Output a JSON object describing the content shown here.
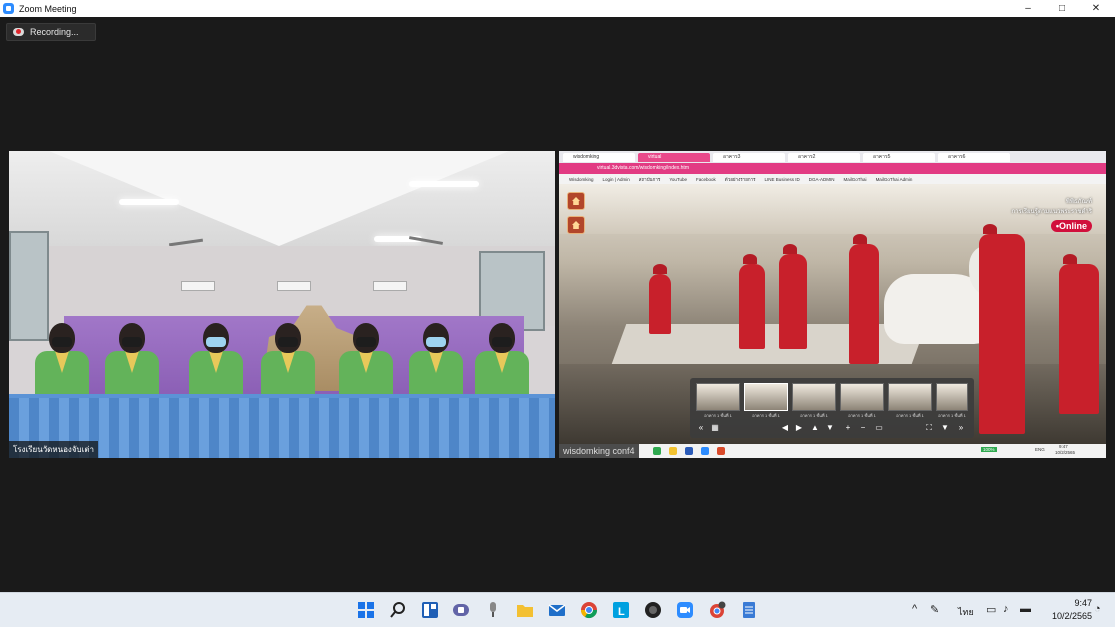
{
  "window": {
    "title": "Zoom Meeting",
    "controls": {
      "minimize": "–",
      "maximize": "□",
      "close": "✕"
    }
  },
  "meeting": {
    "recording_label": "Recording...",
    "participants": [
      {
        "name": "โรงเรียนวัดหนองจับเต่า"
      },
      {
        "name": "wisdomking conf4"
      }
    ]
  },
  "shared_screen": {
    "tabs": [
      "wisdomking",
      "virtual",
      "อาคาร3",
      "อาคาร2",
      "อาคาร5",
      "อาคาร6"
    ],
    "url": "virtual.3dvista.com/wisdomking/index.htm",
    "bookmarks": [
      "Wisdomking",
      "Login | Admin",
      "สถาบันการ",
      "YouTube",
      "Facebook",
      "ตัวอย่างรายการ",
      "LINE Business ID",
      "DGA-ADMIN",
      "MailGoThai",
      "MailGoThai Admin"
    ],
    "promo_lines": [
      "พิพิธภัณฑ์",
      "การเรียนรู้ตามแนวพระราชดำริ"
    ],
    "online_badge": "•Online",
    "thumbnails": [
      "อาคาร 1 ชั้นที่ 1",
      "อาคาร 1 ชั้นที่ 1",
      "อาคาร 1 ชั้นที่ 1",
      "อาคาร 1 ชั้นที่ 1",
      "อาคาร 1 ชั้นที่ 1",
      "อาคาร 1 ชั้นที่ 1"
    ],
    "taskbar": {
      "zoom": "100%",
      "lang": "ENG",
      "time": "9:47",
      "date": "10/2/2565"
    }
  },
  "taskbar": {
    "apps": [
      "start-icon",
      "search-icon",
      "widgets-icon",
      "teams-chat-icon",
      "microphone-app-icon",
      "file-explorer-icon",
      "mail-icon",
      "chrome-icon",
      "line-icon",
      "obs-icon",
      "zoom-icon",
      "chrome-profile-icon",
      "notepad-icon"
    ],
    "language": "ไทย",
    "time": "9:47",
    "date": "10/2/2565"
  },
  "colors": {
    "meeting_bg": "#1a1a1a",
    "taskbar_bg": "#e6ecf3",
    "zoom_blue": "#2d8cff",
    "recording_red": "#e0252b",
    "share_pink": "#e23b83",
    "online_red": "#d10f3c"
  }
}
